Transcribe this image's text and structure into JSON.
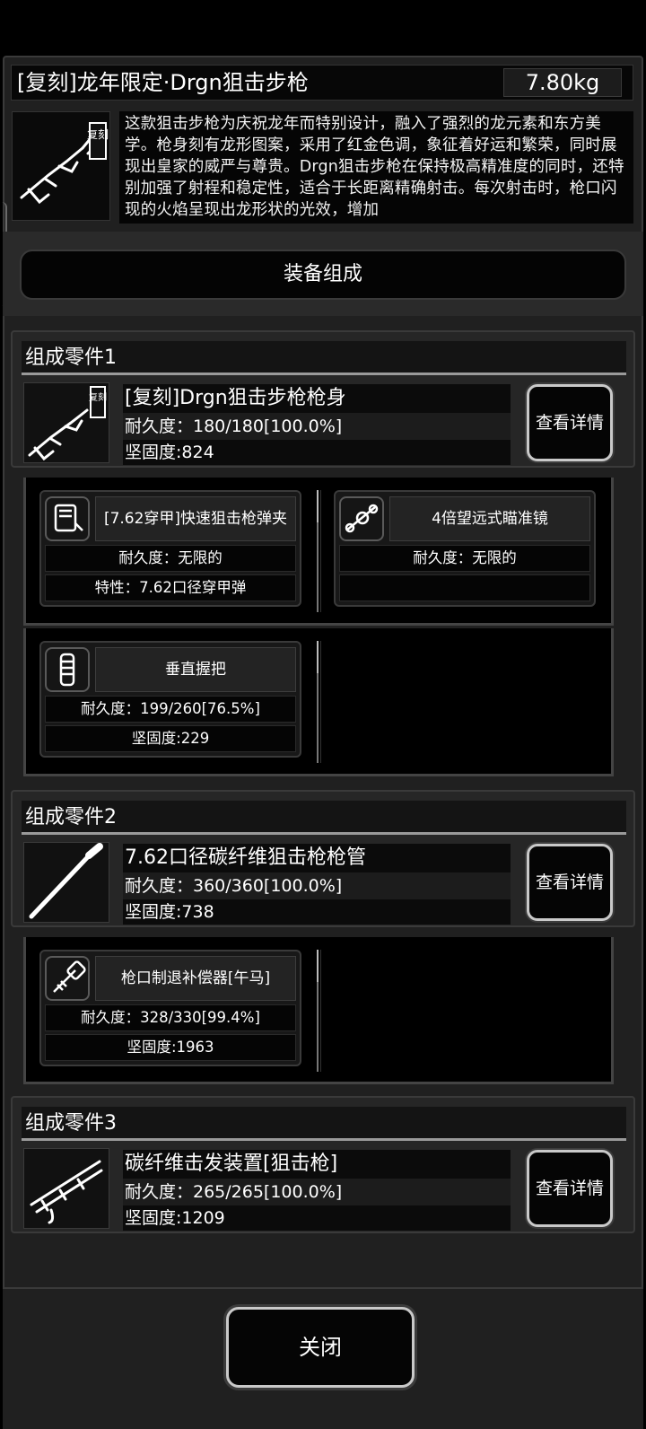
{
  "item": {
    "title": "[复刻]龙年限定·Drgn狙击步枪",
    "weight": "7.80kg",
    "description": "这款狙击步枪为庆祝龙年而特别设计，融入了强烈的龙元素和东方美学。枪身刻有龙形图案，采用了红金色调，象征着好运和繁荣，同时展现出皇家的威严与尊贵。Drgn狙击步枪在保持极高精准度的同时，还特别加强了射程和稳定性，适合于长距离精确射击。每次射击时，枪口闪现的火焰呈现出龙形状的光效，增加",
    "icon_badge": "复刻"
  },
  "section_header": "装备组成",
  "parts": [
    {
      "title": "组成零件1",
      "name": "[复刻]Drgn狙击步枪枪身",
      "durability": "耐久度：180/180[100.0%]",
      "hardness": "坚固度:824",
      "detail_button": "查看详情",
      "icon": "rifle-body-icon",
      "icon_badge": "复刻"
    },
    {
      "title": "组成零件2",
      "name": "7.62口径碳纤维狙击枪枪管",
      "durability": "耐久度：360/360[100.0%]",
      "hardness": "坚固度:738",
      "detail_button": "查看详情",
      "icon": "barrel-icon"
    },
    {
      "title": "组成零件3",
      "name": "碳纤维击发装置[狙击枪]",
      "durability": "耐久度：265/265[100.0%]",
      "hardness": "坚固度:1209",
      "detail_button": "查看详情",
      "icon": "trigger-icon"
    }
  ],
  "attachments": {
    "part1": [
      {
        "name": "[7.62穿甲]快速狙击枪弹夹",
        "line1": "耐久度：无限的",
        "line2": "特性：7.62口径穿甲弹",
        "icon": "magazine-icon"
      },
      {
        "name": "4倍望远式瞄准镜",
        "line1": "耐久度：无限的",
        "line2": "",
        "icon": "scope-icon"
      },
      {
        "name": "垂直握把",
        "line1": "耐久度：199/260[76.5%]",
        "line2": "坚固度:229",
        "icon": "grip-icon"
      }
    ],
    "part2": [
      {
        "name": "枪口制退补偿器[午马]",
        "line1": "耐久度：328/330[99.4%]",
        "line2": "坚固度:1963",
        "icon": "muzzle-brake-icon"
      }
    ]
  },
  "close_button": "关闭",
  "colors": {
    "background": "#202020",
    "panel_dark": "#050505",
    "border": "#3a3a3a",
    "button_border": "#c9c9c9",
    "text": "#ffffff"
  }
}
